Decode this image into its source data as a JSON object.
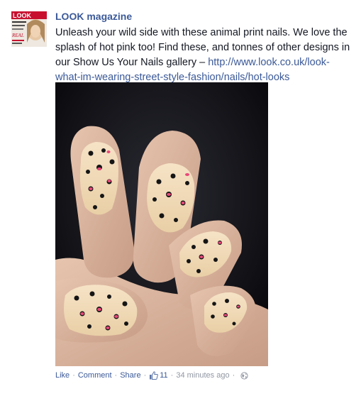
{
  "post": {
    "author": "LOOK magazine",
    "message_text": "Unleash your wild side with these animal print nails. We love the splash of hot pink too! Find these, and tonnes of other designs in our Show Us Your Nails gallery – ",
    "link_text": "http://www.look.co.uk/look-what-im-wearing-street-style-fashion/nails/hot-looks",
    "avatar": {
      "masthead": "LOOK",
      "lines": [
        "DOUBT",
        "Spring/Summer",
        "REAL",
        "prog Bits"
      ]
    },
    "photo": {
      "description_icon": "photo-icon",
      "nail_base_color": "#f1d8b2",
      "spot_color": "#151515",
      "pink_color": "#e8487a",
      "skin_color": "#d9b6a0"
    }
  },
  "actions": {
    "like": "Like",
    "comment": "Comment",
    "share": "Share",
    "like_count": "11",
    "timestamp": "34 minutes ago",
    "separator": "·",
    "privacy_icon": "globe-icon",
    "like_icon": "thumbs-up-icon"
  },
  "colors": {
    "link": "#3b5998",
    "meta": "#9197a3",
    "text": "#141823"
  }
}
